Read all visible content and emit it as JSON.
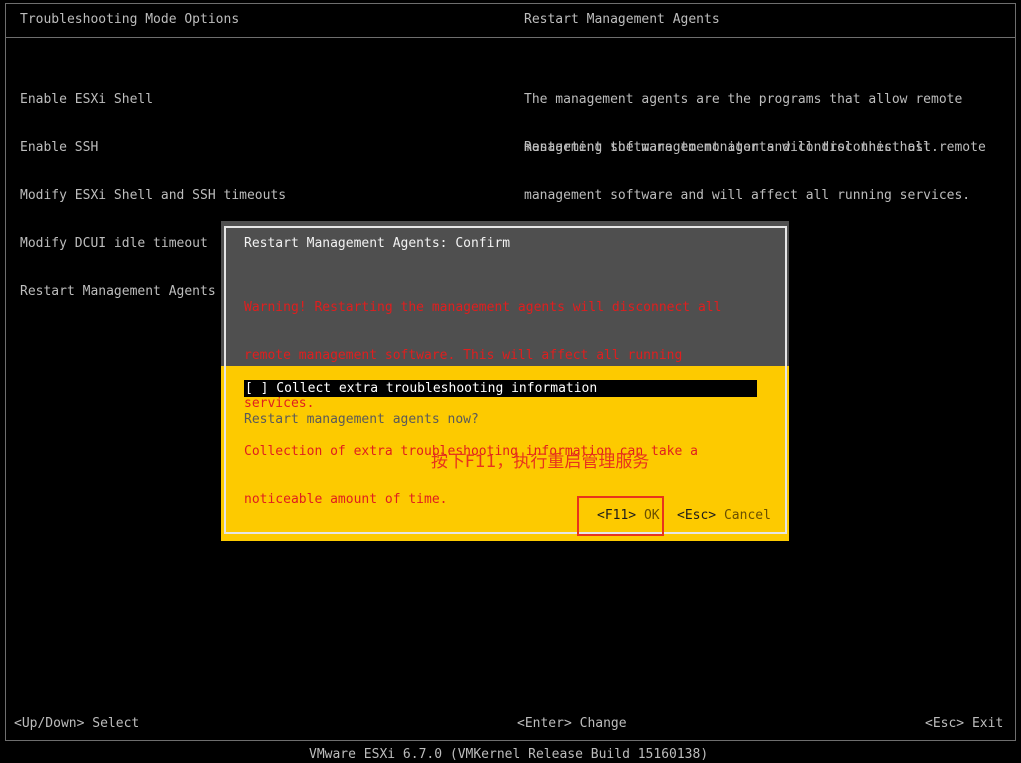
{
  "header": {
    "left_title": "Troubleshooting Mode Options",
    "right_title": "Restart Management Agents"
  },
  "menu": {
    "items": [
      "Enable ESXi Shell",
      "Enable SSH",
      "Modify ESXi Shell and SSH timeouts",
      "Modify DCUI idle timeout",
      "Restart Management Agents"
    ]
  },
  "description": {
    "para1": [
      "The management agents are the programs that allow remote",
      "management software to monitor and control this host."
    ],
    "para2": [
      "Restarting the management agents will disconnect all remote",
      "management software and will affect all running services."
    ]
  },
  "dialog": {
    "title": "Restart Management Agents: Confirm",
    "warning_lines": [
      "Warning! Restarting the management agents will disconnect all",
      "remote management software. This will affect all running",
      "services.",
      "Collection of extra troubleshooting information can take a",
      "noticeable amount of time."
    ],
    "checkbox_label": "[ ] Collect extra troubleshooting information",
    "question": "Restart management agents now?",
    "annotation": "按下F11，执行重启管理服务",
    "ok_key": "<F11>",
    "ok_label": "OK",
    "cancel_key": "<Esc>",
    "cancel_label": "Cancel"
  },
  "footer": {
    "left": "<Up/Down> Select",
    "center": "<Enter> Change",
    "right": "<Esc> Exit",
    "version": "VMware ESXi 6.7.0 (VMKernel Release Build 15160138)"
  },
  "colors": {
    "background": "#000000",
    "dialog_header": "#4f4f4f",
    "dialog_body": "#fdca00",
    "warning_text": "#e01e1e",
    "annotation": "#e8341c"
  }
}
